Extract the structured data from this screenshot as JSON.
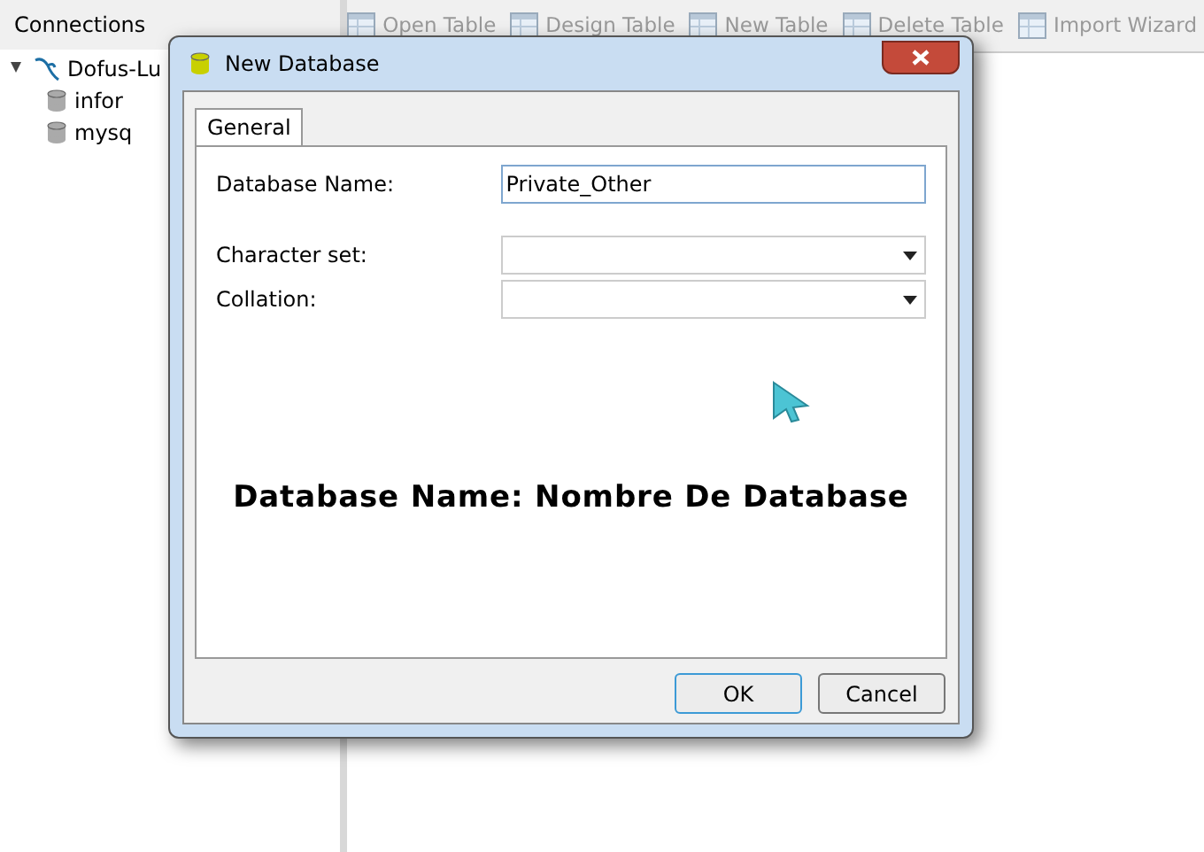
{
  "connections_panel": {
    "title": "Connections",
    "tree": [
      {
        "label": "Dofus-Lu",
        "expanded": true,
        "children": [
          {
            "label": "infor"
          },
          {
            "label": "mysq"
          }
        ]
      }
    ]
  },
  "toolbar": [
    {
      "label": "Open Table"
    },
    {
      "label": "Design Table"
    },
    {
      "label": "New Table"
    },
    {
      "label": "Delete Table"
    },
    {
      "label": "Import Wizard"
    }
  ],
  "dialog": {
    "title": "New Database",
    "tabs": [
      {
        "label": "General",
        "selected": true
      }
    ],
    "fields": [
      {
        "kind": "text",
        "label": "Database Name:",
        "value": "Private_Other"
      },
      {
        "kind": "select",
        "label": "Character set:"
      },
      {
        "kind": "select",
        "label": "Collation:"
      }
    ],
    "annotation": "Database Name: Nombre De Database",
    "buttons": [
      {
        "label": "OK",
        "default": true
      },
      {
        "label": "Cancel",
        "default": false
      }
    ]
  }
}
